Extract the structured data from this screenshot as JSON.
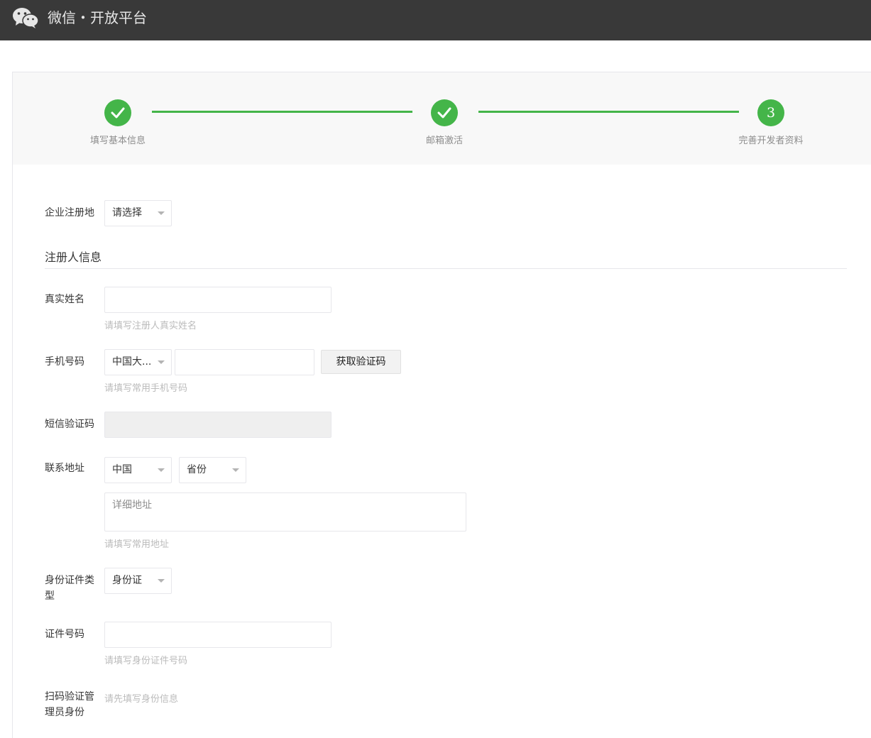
{
  "header": {
    "brand": "微信・开放平台",
    "logo_icon": "wechat-logo-icon"
  },
  "steps": [
    {
      "label": "填写基本信息",
      "state": "done",
      "icon": "check-icon"
    },
    {
      "label": "邮箱激活",
      "state": "done",
      "icon": "check-icon"
    },
    {
      "label": "完善开发者资料",
      "state": "current",
      "number": "3"
    }
  ],
  "colors": {
    "accent": "#44b549",
    "topbar": "#393939",
    "hint": "#bbbbbb"
  },
  "form": {
    "company_region": {
      "label": "企业注册地",
      "value": "请选择"
    },
    "section_title": "注册人信息",
    "real_name": {
      "label": "真实姓名",
      "value": "",
      "hint": "请填写注册人真实姓名"
    },
    "phone": {
      "label": "手机号码",
      "country": "中国大...",
      "value": "",
      "button": "获取验证码",
      "hint": "请填写常用手机号码"
    },
    "sms_code": {
      "label": "短信验证码",
      "value": ""
    },
    "address": {
      "label": "联系地址",
      "country": "中国",
      "province": "省份",
      "detail_placeholder": "详细地址",
      "hint": "请填写常用地址"
    },
    "id_type": {
      "label": "身份证件类型",
      "value": "身份证"
    },
    "id_number": {
      "label": "证件号码",
      "value": "",
      "hint": "请填写身份证件号码"
    },
    "scan_verify": {
      "label": "扫码验证管理员身份",
      "hint": "请先填写身份信息"
    }
  }
}
